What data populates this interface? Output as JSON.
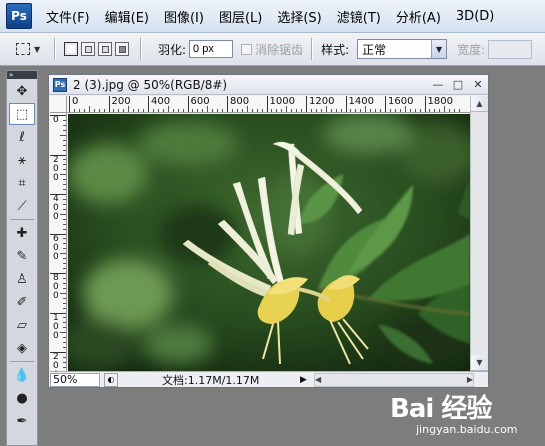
{
  "app": {
    "logo": "Ps"
  },
  "menu": [
    "文件(F)",
    "编辑(E)",
    "图像(I)",
    "图层(L)",
    "选择(S)",
    "滤镜(T)",
    "分析(A)",
    "3D(D)"
  ],
  "options": {
    "feather_label": "羽化:",
    "feather_value": "0 px",
    "antialias_label": "消除锯齿",
    "style_label": "样式:",
    "style_value": "正常",
    "width_label": "宽度:"
  },
  "toolbox": {
    "grip": "»",
    "tools": [
      {
        "name": "move-tool",
        "glyph": "✥",
        "active": false
      },
      {
        "name": "marquee-tool",
        "glyph": "⬚",
        "active": true
      },
      {
        "name": "lasso-tool",
        "glyph": "ℓ",
        "active": false
      },
      {
        "name": "magic-wand-tool",
        "glyph": "⚹",
        "active": false
      },
      {
        "name": "crop-tool",
        "glyph": "⌗",
        "active": false
      },
      {
        "name": "eyedropper-tool",
        "glyph": "⟋",
        "active": false
      },
      {
        "name": "healing-brush-tool",
        "glyph": "✚",
        "active": false
      },
      {
        "name": "brush-tool",
        "glyph": "✎",
        "active": false
      },
      {
        "name": "clone-stamp-tool",
        "glyph": "♙",
        "active": false
      },
      {
        "name": "history-brush-tool",
        "glyph": "✐",
        "active": false
      },
      {
        "name": "eraser-tool",
        "glyph": "▱",
        "active": false
      },
      {
        "name": "paint-bucket-tool",
        "glyph": "◈",
        "active": false
      },
      {
        "name": "blur-tool",
        "glyph": "💧",
        "active": false
      },
      {
        "name": "dodge-tool",
        "glyph": "●",
        "active": false
      },
      {
        "name": "pen-tool",
        "glyph": "✒",
        "active": false
      }
    ]
  },
  "document": {
    "title": "2 (3).jpg @ 50%(RGB/8#)",
    "ruler_h": [
      "0",
      "200",
      "400",
      "600",
      "800",
      "1000",
      "1200",
      "1400",
      "1600",
      "1800"
    ],
    "ruler_v": [
      "0",
      "2",
      "4",
      "6",
      "8",
      "1",
      "2",
      "4"
    ],
    "zoom": "50%",
    "doc_info": "文档:1.17M/1.17M"
  },
  "watermark": {
    "logo": "Bai  经验",
    "url": "jingyan.baidu.com"
  }
}
